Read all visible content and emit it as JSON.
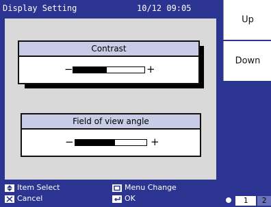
{
  "header": {
    "title": "Display Setting",
    "datetime": "10/12 09:05"
  },
  "settings": [
    {
      "label": "Contrast",
      "minus": "−",
      "plus": "+",
      "level": 0.47
    },
    {
      "label": "Field of view angle",
      "minus": "−",
      "plus": "+",
      "level": 0.56
    }
  ],
  "side_buttons": {
    "up": "Up",
    "down": "Down"
  },
  "help": {
    "item_select": "Item Select",
    "cancel": "Cancel",
    "menu_change": "Menu Change",
    "ok": "OK"
  },
  "pager": {
    "page1": "1",
    "page2": "2"
  },
  "icons": {
    "updown": "updown-arrow-icon",
    "cancel": "cancel-icon",
    "menu": "menu-icon",
    "enter": "enter-icon",
    "eye": "eye-icon"
  }
}
